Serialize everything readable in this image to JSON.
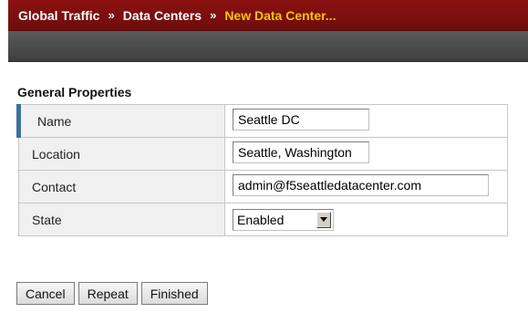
{
  "breadcrumb": {
    "items": [
      "Global Traffic",
      "Data Centers"
    ],
    "separator": "»",
    "current": "New Data Center..."
  },
  "section": {
    "title": "General Properties"
  },
  "properties": {
    "name": {
      "label": "Name",
      "value": "Seattle DC"
    },
    "location": {
      "label": "Location",
      "value": "Seattle, Washington"
    },
    "contact": {
      "label": "Contact",
      "value": "admin@f5seattledatacenter.com"
    },
    "state": {
      "label": "State",
      "value": "Enabled"
    }
  },
  "buttons": {
    "cancel": "Cancel",
    "repeat": "Repeat",
    "finished": "Finished"
  },
  "colors": {
    "breadcrumb_bg": "#8c1111",
    "breadcrumb_current": "#f5c400",
    "toolbar_bg": "#4a4a4a",
    "selected_row_marker": "#3d6f9e"
  }
}
